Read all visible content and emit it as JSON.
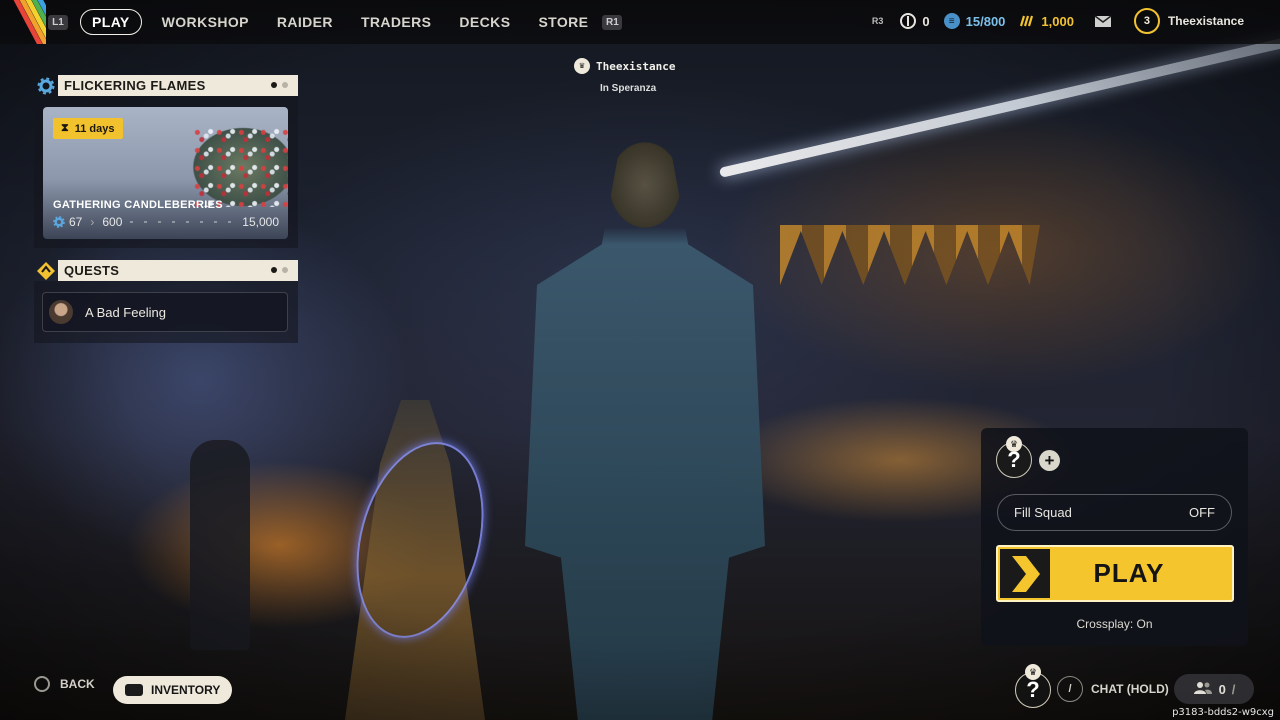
{
  "topbar": {
    "left_hint": "L1",
    "right_hint": "R1",
    "tabs": [
      {
        "label": "PLAY",
        "active": true
      },
      {
        "label": "WORKSHOP",
        "active": false
      },
      {
        "label": "RAIDER",
        "active": false
      },
      {
        "label": "TRADERS",
        "active": false
      },
      {
        "label": "DECKS",
        "active": false
      },
      {
        "label": "STORE",
        "active": false
      }
    ],
    "r3_hint": "R3",
    "tokens": "0",
    "storage": "15/800",
    "coins": "1,000",
    "level": "3",
    "username": "Theexistance"
  },
  "event": {
    "title": "FLICKERING FLAMES",
    "days": "11 days",
    "card_title": "GATHERING CANDLEBERRIES",
    "current": "67",
    "next": "600",
    "goal": "15,000"
  },
  "quests": {
    "title": "QUESTS",
    "items": [
      {
        "label": "A Bad Feeling"
      }
    ]
  },
  "player": {
    "name": "Theexistance",
    "location": "In Speranza"
  },
  "squad": {
    "fill_label": "Fill Squad",
    "fill_value": "OFF",
    "play_label": "PLAY",
    "crossplay": "Crossplay: On"
  },
  "bottom": {
    "back": "BACK",
    "inventory": "INVENTORY",
    "chat": "CHAT (HOLD)",
    "friends_count": "0",
    "build_id": "p3183-bdds2-w9cxg"
  },
  "colors": {
    "accent": "#f4c52c",
    "panel_header": "#efe9dc",
    "event_icon": "#5aa8e0"
  }
}
